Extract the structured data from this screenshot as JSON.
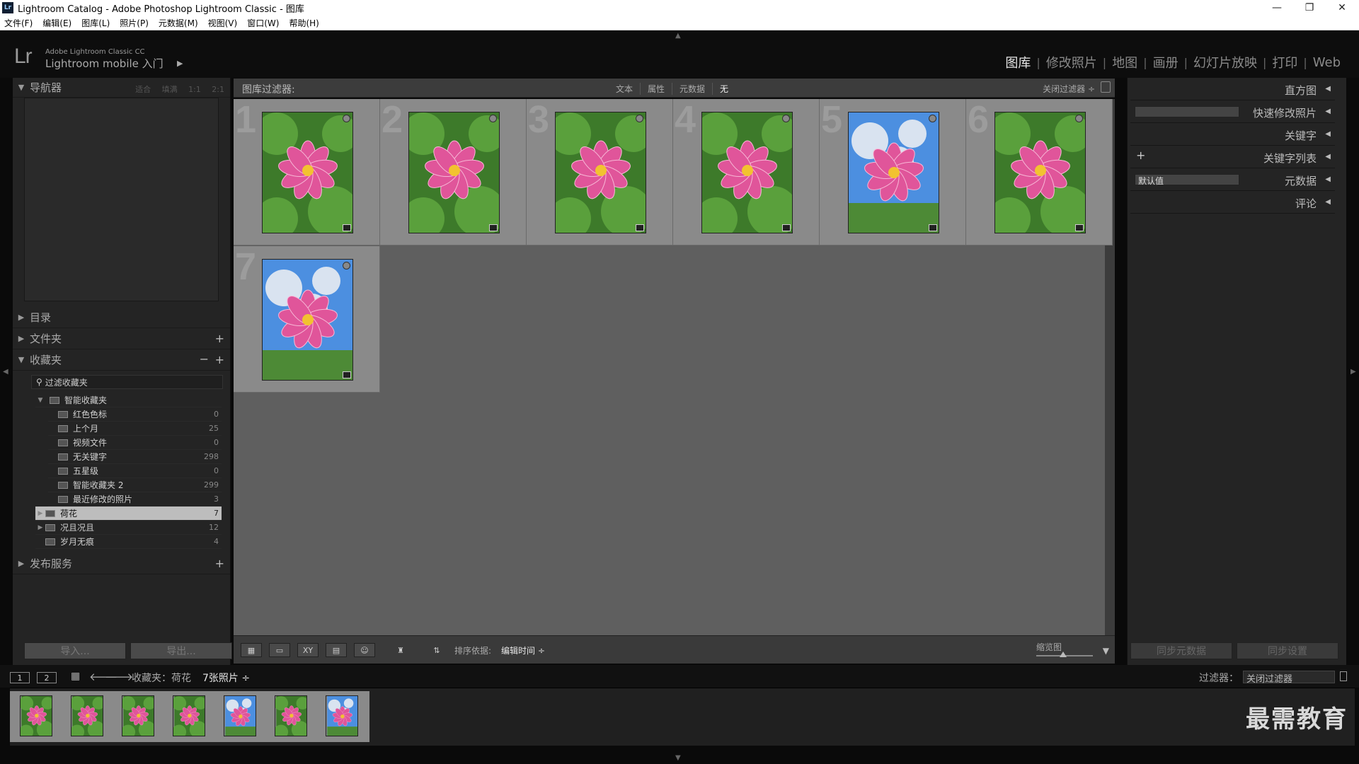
{
  "window": {
    "title": "Lightroom Catalog - Adobe Photoshop Lightroom Classic - 图库",
    "app_icon": "Lr",
    "controls": {
      "minimize": "—",
      "maximize": "❐",
      "close": "✕"
    }
  },
  "menu": [
    "文件(F)",
    "编辑(E)",
    "图库(L)",
    "照片(P)",
    "元数据(M)",
    "视图(V)",
    "窗口(W)",
    "帮助(H)"
  ],
  "identity": {
    "logo": "Lr",
    "small": "Adobe Lightroom Classic CC",
    "mobile": "Lightroom mobile 入门",
    "arrow": "▶"
  },
  "modules": {
    "items": [
      "图库",
      "修改照片",
      "地图",
      "画册",
      "幻灯片放映",
      "打印",
      "Web"
    ],
    "active": "图库"
  },
  "left_panel": {
    "navigator": {
      "label": "导航器",
      "options": [
        "适合",
        "填满",
        "1:1",
        "2:1"
      ]
    },
    "catalog": "目录",
    "folders": "文件夹",
    "collections": "收藏夹",
    "collection_filter_placeholder": "过滤收藏夹",
    "smart_collection_set": "智能收藏夹",
    "smart_collections": [
      {
        "name": "红色色标",
        "count": "0"
      },
      {
        "name": "上个月",
        "count": "25"
      },
      {
        "name": "视频文件",
        "count": "0"
      },
      {
        "name": "无关键字",
        "count": "298"
      },
      {
        "name": "五星级",
        "count": "0"
      },
      {
        "name": "智能收藏夹 2",
        "count": "299"
      },
      {
        "name": "最近修改的照片",
        "count": "3"
      }
    ],
    "collection_sets": [
      {
        "name": "荷花",
        "count": "7",
        "selected": true
      },
      {
        "name": "况且况且",
        "count": "12"
      },
      {
        "name": "岁月无痕",
        "count": "4"
      }
    ],
    "publish_services": "发布服务",
    "import_button": "导入...",
    "export_button": "导出..."
  },
  "filter_bar": {
    "title": "图库过滤器:",
    "options": [
      "文本",
      "属性",
      "元数据",
      "无"
    ],
    "close_filter": "关闭过滤器 ÷"
  },
  "grid": {
    "cells": [
      {
        "index": "1"
      },
      {
        "index": "2"
      },
      {
        "index": "3"
      },
      {
        "index": "4"
      },
      {
        "index": "5"
      },
      {
        "index": "6"
      },
      {
        "index": "7"
      }
    ]
  },
  "toolbar": {
    "sort_label": "排序依据:",
    "sort_value": "编辑时间 ÷",
    "thumbnail_label": "缩览图",
    "menu_arrow": "▼"
  },
  "right_panel": {
    "histogram": "直方图",
    "quick_develop": "快速修改照片",
    "keywording": "关键字",
    "keyword_list": "关键字列表",
    "metadata": "元数据",
    "metadata_preset": "默认值",
    "comments": "评论",
    "sync_metadata": "同步元数据",
    "sync_settings": "同步设置"
  },
  "filmstrip_bar": {
    "screen1": "1",
    "screen2": "2",
    "source": "收藏夹：荷花",
    "count": "7张照片 ÷",
    "filter_label": "过滤器：",
    "filter_value": "关闭过滤器"
  },
  "watermark": "最需教育",
  "colors": {
    "grid_bg": "#5f5f5f",
    "cell_bg": "#8a8a8a",
    "selected_row": "#bdbdbd",
    "lotus_pink": "#e0559a",
    "leaf_green": "#3d7a2a",
    "sky_blue": "#4c8fe0"
  }
}
